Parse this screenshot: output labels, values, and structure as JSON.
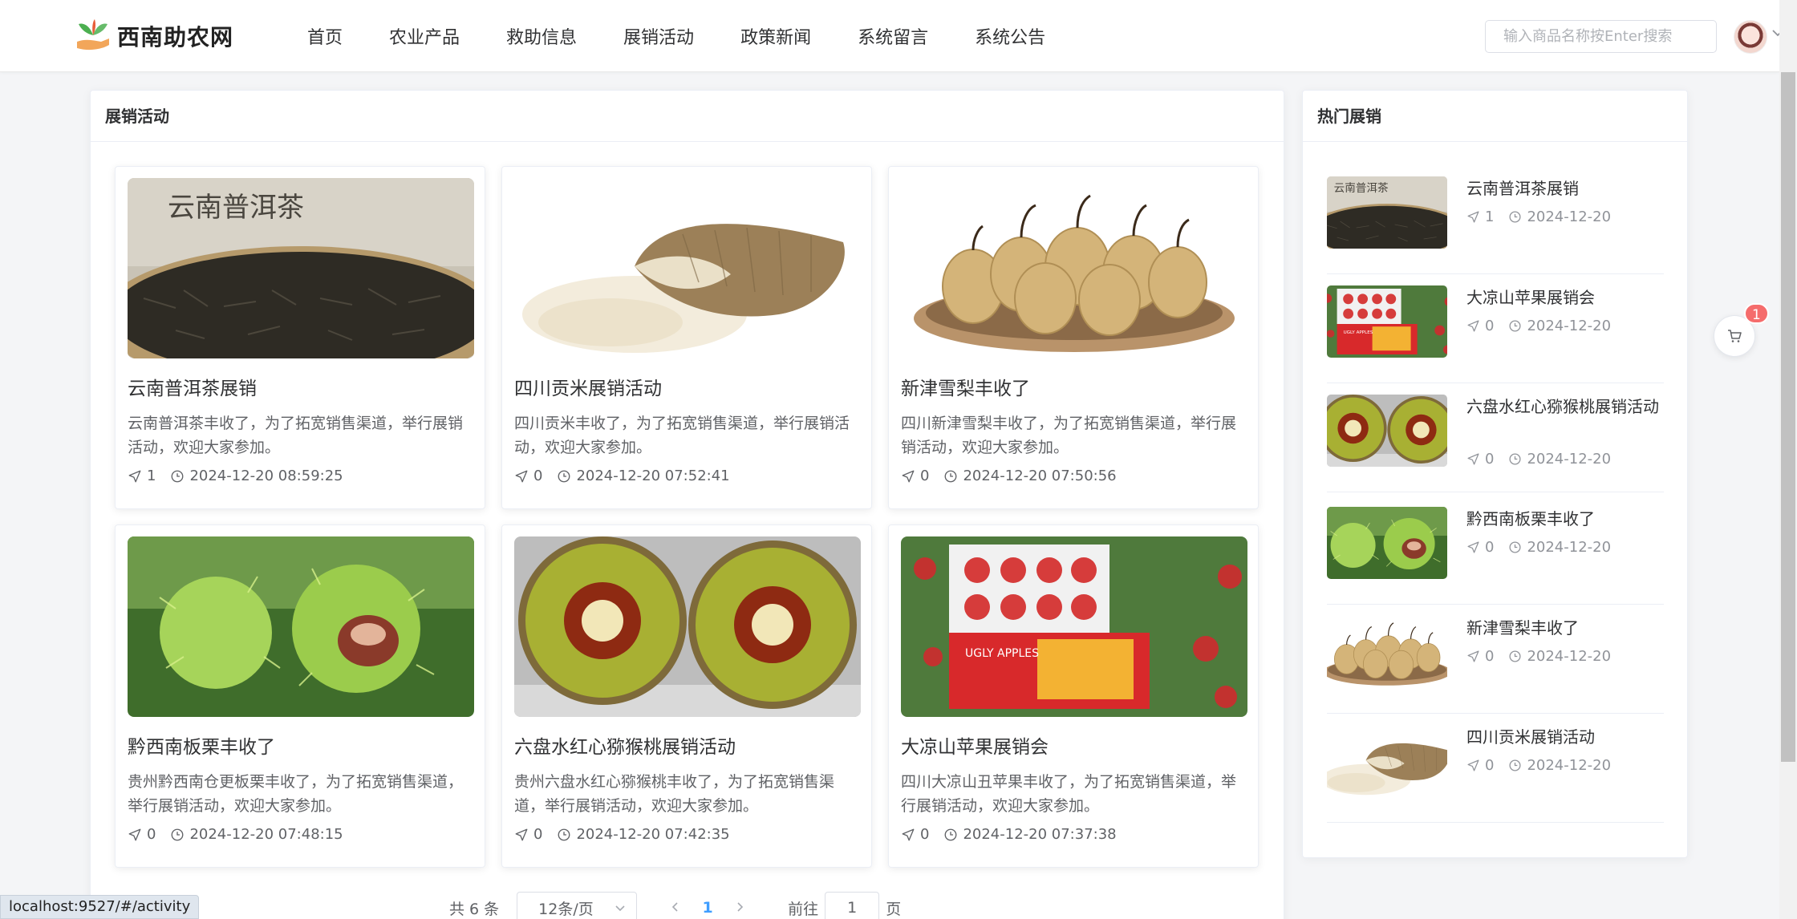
{
  "header": {
    "logo_text": "西南助农网",
    "nav": [
      "首页",
      "农业产品",
      "救助信息",
      "展销活动",
      "政策新闻",
      "系统留言",
      "系统公告"
    ],
    "search_placeholder": "输入商品名称按Enter搜索"
  },
  "main": {
    "title": "展销活动",
    "cards": [
      {
        "title": "云南普洱茶展销",
        "desc": "云南普洱茶丰收了，为了拓宽销售渠道，举行展销活动，欢迎大家参加。",
        "count": "1",
        "time": "2024-12-20 08:59:25",
        "image": "tea"
      },
      {
        "title": "四川贡米展销活动",
        "desc": "四川贡米丰收了，为了拓宽销售渠道，举行展销活动，欢迎大家参加。",
        "count": "0",
        "time": "2024-12-20 07:52:41",
        "image": "rice"
      },
      {
        "title": "新津雪梨丰收了",
        "desc": "四川新津雪梨丰收了，为了拓宽销售渠道，举行展销活动，欢迎大家参加。",
        "count": "0",
        "time": "2024-12-20 07:50:56",
        "image": "pear"
      },
      {
        "title": "黔西南板栗丰收了",
        "desc": "贵州黔西南仓更板栗丰收了，为了拓宽销售渠道，举行展销活动，欢迎大家参加。",
        "count": "0",
        "time": "2024-12-20 07:48:15",
        "image": "chestnut"
      },
      {
        "title": "六盘水红心猕猴桃展销活动",
        "desc": "贵州六盘水红心猕猴桃丰收了，为了拓宽销售渠道，举行展销活动，欢迎大家参加。",
        "count": "0",
        "time": "2024-12-20 07:42:35",
        "image": "kiwi"
      },
      {
        "title": "大凉山苹果展销会",
        "desc": "四川大凉山丑苹果丰收了，为了拓宽销售渠道，举行展销活动，欢迎大家参加。",
        "count": "0",
        "time": "2024-12-20 07:37:38",
        "image": "apple"
      }
    ]
  },
  "pagination": {
    "total": "共 6 条",
    "page_size": "12条/页",
    "current": "1",
    "goto_prefix": "前往",
    "goto_value": "1",
    "goto_suffix": "页"
  },
  "sidebar": {
    "title": "热门展销",
    "items": [
      {
        "title": "云南普洱茶展销",
        "count": "1",
        "date": "2024-12-20",
        "image": "tea"
      },
      {
        "title": "大凉山苹果展销会",
        "count": "0",
        "date": "2024-12-20",
        "image": "apple"
      },
      {
        "title": "六盘水红心猕猴桃展销活动",
        "count": "0",
        "date": "2024-12-20",
        "image": "kiwi"
      },
      {
        "title": "黔西南板栗丰收了",
        "count": "0",
        "date": "2024-12-20",
        "image": "chestnut"
      },
      {
        "title": "新津雪梨丰收了",
        "count": "0",
        "date": "2024-12-20",
        "image": "pear"
      },
      {
        "title": "四川贡米展销活动",
        "count": "0",
        "date": "2024-12-20",
        "image": "rice"
      }
    ]
  },
  "cart": {
    "badge": "1"
  },
  "status_bar": {
    "url": "localhost:9527/#/activity"
  },
  "colors": {
    "accent": "#409eff",
    "badge": "#f56c6c",
    "text": "#303133",
    "muted": "#909399"
  },
  "icons": [
    "logo-icon",
    "send-icon",
    "clock-icon",
    "cart-icon",
    "chevron-down-icon",
    "chevron-left-icon",
    "chevron-right-icon"
  ]
}
